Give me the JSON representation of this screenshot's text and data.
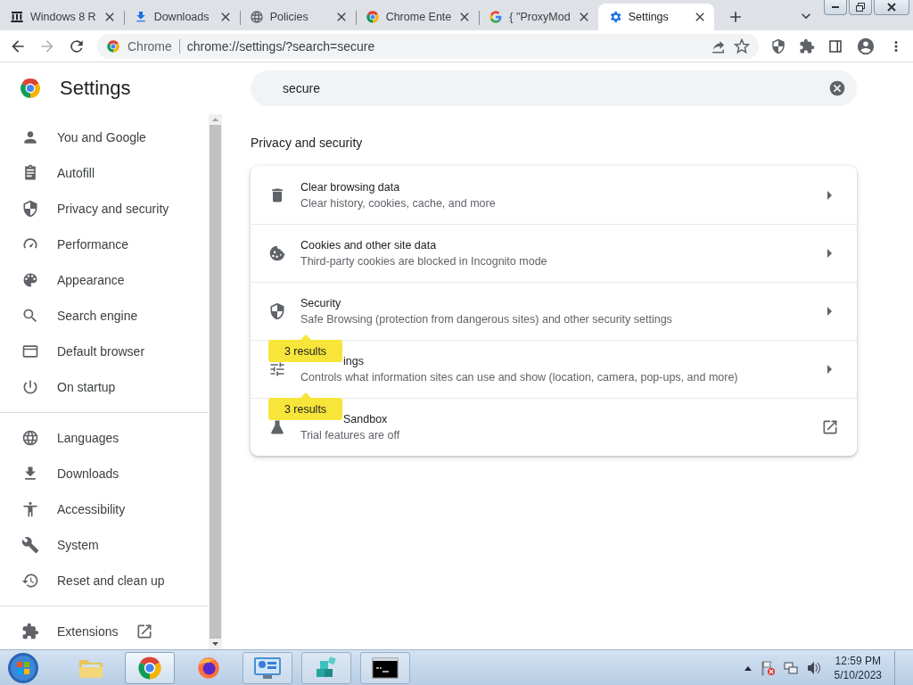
{
  "tabs": [
    {
      "title": "Windows 8 R",
      "selected": false
    },
    {
      "title": "Downloads",
      "selected": false
    },
    {
      "title": "Policies",
      "selected": false
    },
    {
      "title": "Chrome Ente",
      "selected": false
    },
    {
      "title": "{ \"ProxyMod",
      "selected": false
    },
    {
      "title": "Settings",
      "selected": true
    }
  ],
  "address": {
    "site_label": "Chrome",
    "url": "chrome://settings/?search=secure"
  },
  "settings_title": "Settings",
  "search": {
    "value": "secure"
  },
  "sidebar": {
    "groups": [
      [
        {
          "label": "You and Google"
        },
        {
          "label": "Autofill"
        },
        {
          "label": "Privacy and security"
        },
        {
          "label": "Performance"
        },
        {
          "label": "Appearance"
        },
        {
          "label": "Search engine"
        },
        {
          "label": "Default browser"
        },
        {
          "label": "On startup"
        }
      ],
      [
        {
          "label": "Languages"
        },
        {
          "label": "Downloads"
        },
        {
          "label": "Accessibility"
        },
        {
          "label": "System"
        },
        {
          "label": "Reset and clean up"
        }
      ],
      [
        {
          "label": "Extensions",
          "kind": "external"
        }
      ]
    ]
  },
  "section_title": "Privacy and security",
  "results": [
    {
      "title": "Clear browsing data",
      "description": "Clear history, cookies, cache, and more",
      "kind": "arrow"
    },
    {
      "title": "Cookies and other site data",
      "description": "Third-party cookies are blocked in Incognito mode",
      "kind": "arrow"
    },
    {
      "title": "Security",
      "description": "Safe Browsing (protection from dangerous sites) and other security settings",
      "kind": "arrow"
    },
    {
      "title": "ings",
      "description": "Controls what information sites can use and show (location, camera, pop-ups, and more)",
      "kind": "arrow",
      "badge": "3 results"
    },
    {
      "title": "Sandbox",
      "description": "Trial features are off",
      "kind": "external",
      "badge": "3 results"
    }
  ],
  "taskbar": {
    "apps": [
      {
        "selected": false
      },
      {
        "selected": true
      },
      {
        "selected": false
      },
      {
        "selected": false
      },
      {
        "selected": false
      },
      {
        "selected": false
      }
    ],
    "time": "12:59 PM",
    "date": "5/10/2023"
  }
}
